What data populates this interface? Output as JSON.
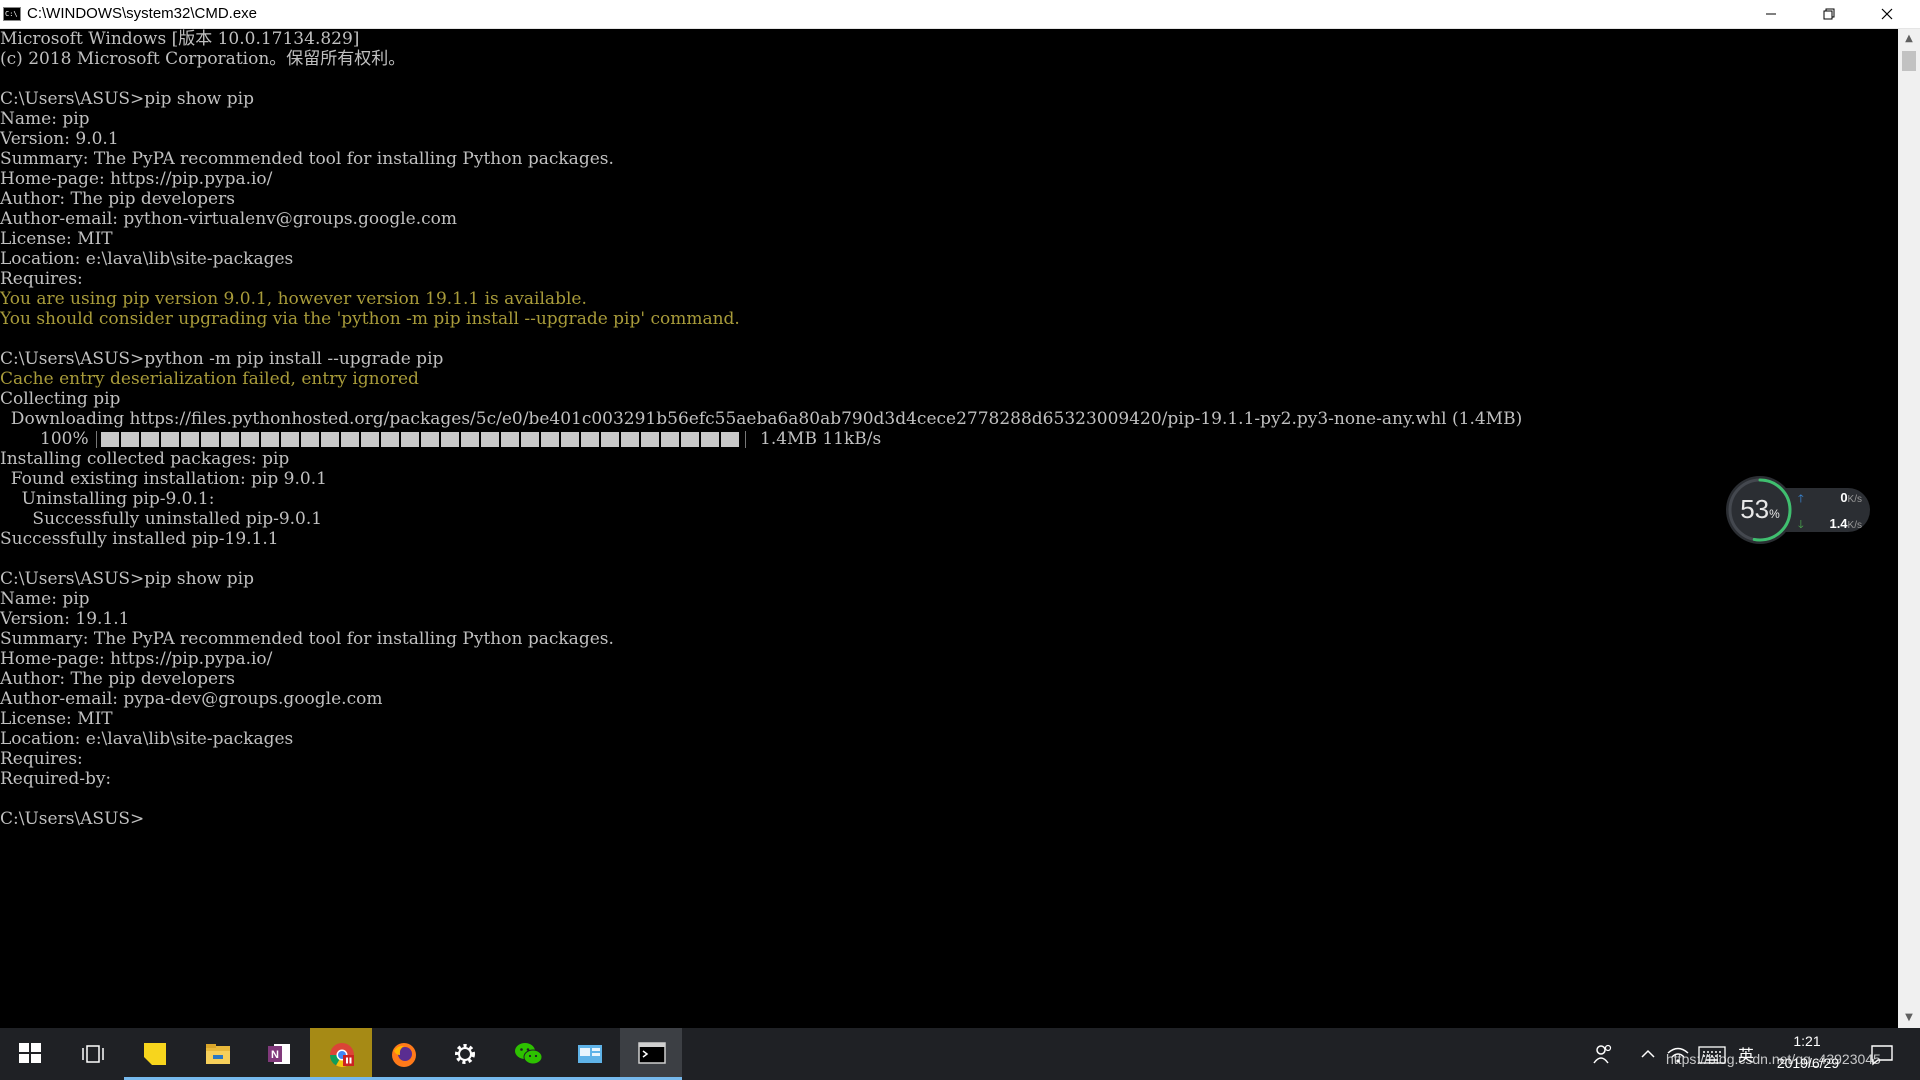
{
  "window": {
    "title": "C:\\WINDOWS\\system32\\CMD.exe",
    "icon_text": "C:\\",
    "controls": [
      "minimize-icon",
      "restore-icon",
      "close-icon"
    ]
  },
  "console": {
    "colors": {
      "normal": "#c0c0c0",
      "warning": "#a89b3a",
      "background": "#000000"
    },
    "lines": [
      {
        "text": "Microsoft Windows [版本 10.0.17134.829]",
        "style": "normal"
      },
      {
        "text": "(c) 2018 Microsoft Corporation。保留所有权利。",
        "style": "normal"
      },
      {
        "text": "",
        "style": "normal"
      },
      {
        "text": "C:\\Users\\ASUS>pip show pip",
        "style": "normal"
      },
      {
        "text": "Name: pip",
        "style": "normal"
      },
      {
        "text": "Version: 9.0.1",
        "style": "normal"
      },
      {
        "text": "Summary: The PyPA recommended tool for installing Python packages.",
        "style": "normal"
      },
      {
        "text": "Home-page: https://pip.pypa.io/",
        "style": "normal"
      },
      {
        "text": "Author: The pip developers",
        "style": "normal"
      },
      {
        "text": "Author-email: python-virtualenv@groups.google.com",
        "style": "normal"
      },
      {
        "text": "License: MIT",
        "style": "normal"
      },
      {
        "text": "Location: e:\\lava\\lib\\site-packages",
        "style": "normal"
      },
      {
        "text": "Requires:",
        "style": "normal"
      },
      {
        "text": "You are using pip version 9.0.1, however version 19.1.1 is available.",
        "style": "warning"
      },
      {
        "text": "You should consider upgrading via the 'python -m pip install --upgrade pip' command.",
        "style": "warning"
      },
      {
        "text": "",
        "style": "normal"
      },
      {
        "text": "C:\\Users\\ASUS>python -m pip install --upgrade pip",
        "style": "normal"
      },
      {
        "text": "Cache entry deserialization failed, entry ignored",
        "style": "warning"
      },
      {
        "text": "Collecting pip",
        "style": "normal"
      },
      {
        "text": "  Downloading https://files.pythonhosted.org/packages/5c/e0/be401c003291b56efc55aeba6a80ab790d3d4cece2778288d65323009420/pip-19.1.1-py2.py3-none-any.whl (1.4MB)",
        "style": "normal"
      },
      {
        "text": "",
        "style": "progress"
      },
      {
        "text": "Installing collected packages: pip",
        "style": "normal"
      },
      {
        "text": "  Found existing installation: pip 9.0.1",
        "style": "normal"
      },
      {
        "text": "    Uninstalling pip-9.0.1:",
        "style": "normal"
      },
      {
        "text": "      Successfully uninstalled pip-9.0.1",
        "style": "normal"
      },
      {
        "text": "Successfully installed pip-19.1.1",
        "style": "normal"
      },
      {
        "text": "",
        "style": "normal"
      },
      {
        "text": "C:\\Users\\ASUS>pip show pip",
        "style": "normal"
      },
      {
        "text": "Name: pip",
        "style": "normal"
      },
      {
        "text": "Version: 19.1.1",
        "style": "normal"
      },
      {
        "text": "Summary: The PyPA recommended tool for installing Python packages.",
        "style": "normal"
      },
      {
        "text": "Home-page: https://pip.pypa.io/",
        "style": "normal"
      },
      {
        "text": "Author: The pip developers",
        "style": "normal"
      },
      {
        "text": "Author-email: pypa-dev@groups.google.com",
        "style": "normal"
      },
      {
        "text": "License: MIT",
        "style": "normal"
      },
      {
        "text": "Location: e:\\lava\\lib\\site-packages",
        "style": "normal"
      },
      {
        "text": "Requires:",
        "style": "normal"
      },
      {
        "text": "Required-by:",
        "style": "normal"
      },
      {
        "text": "",
        "style": "normal"
      },
      {
        "text": "C:\\Users\\ASUS>",
        "style": "normal"
      }
    ],
    "progress": {
      "percent_label": "100%",
      "fraction": 1.0,
      "stats": "1.4MB 11kB/s"
    }
  },
  "network_monitor": {
    "percent": "53",
    "percent_sign": "%",
    "gauge_fraction": 0.53,
    "upload_value": "0",
    "download_value": "1.4",
    "unit": "K/s",
    "colors": {
      "upload": "#3b8de0",
      "download": "#4caf50",
      "gauge": "#3fbf6f"
    }
  },
  "taskbar": {
    "apps": [
      {
        "name": "start-button",
        "icon": "windows-logo-icon",
        "state": "normal"
      },
      {
        "name": "task-view-button",
        "icon": "task-view-icon",
        "state": "normal"
      },
      {
        "name": "taskbar-sticky-notes",
        "icon": "sticky-notes-icon",
        "state": "open"
      },
      {
        "name": "taskbar-file-explorer",
        "icon": "folder-icon",
        "state": "open"
      },
      {
        "name": "taskbar-onenote",
        "icon": "onenote-icon",
        "state": "open"
      },
      {
        "name": "taskbar-chrome",
        "icon": "chrome-icon",
        "state": "highlight"
      },
      {
        "name": "taskbar-firefox",
        "icon": "firefox-icon",
        "state": "open"
      },
      {
        "name": "taskbar-settings",
        "icon": "gear-icon",
        "state": "open"
      },
      {
        "name": "taskbar-wechat",
        "icon": "wechat-icon",
        "state": "open"
      },
      {
        "name": "taskbar-control-panel",
        "icon": "control-panel-icon",
        "state": "open"
      },
      {
        "name": "taskbar-cmd",
        "icon": "cmd-icon",
        "state": "active"
      }
    ],
    "tray": {
      "ime": "英",
      "time": "1:21",
      "date": "2019/6/29",
      "watermark": "https://blog.csdn.net/qq_43923045"
    }
  }
}
